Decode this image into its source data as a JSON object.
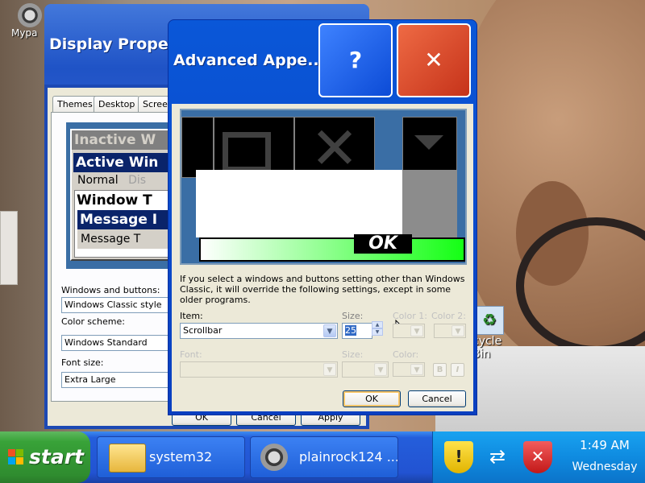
{
  "desktop": {
    "icons": [
      {
        "label": "Mypa"
      },
      {
        "label": "cycle\nBin"
      }
    ]
  },
  "display_properties": {
    "title": "Display Propert",
    "tabs": [
      "Themes",
      "Desktop",
      "Screen"
    ],
    "preview": {
      "inactive_window": "Inactive W",
      "active_window": "Active Win",
      "menu_normal": "Normal",
      "menu_disabled": "Dis",
      "window_text": "Window T",
      "message_box": "Message I",
      "message_text": "Message T"
    },
    "windows_and_buttons_label": "Windows and buttons:",
    "windows_and_buttons_value": "Windows Classic style",
    "color_scheme_label": "Color scheme:",
    "color_scheme_value": "Windows Standard",
    "font_size_label": "Font size:",
    "font_size_value": "Extra Large",
    "bottom_buttons": [
      "OK",
      "Cancel",
      "Apply"
    ]
  },
  "advanced_appearance": {
    "title": "Advanced Appe...",
    "help_label": "?",
    "close_label": "✕",
    "preview_ok": "OK",
    "note": "If you select a windows and buttons setting other than Windows Classic, it will override the following settings, except in some older programs.",
    "item_label": "Item:",
    "item_value": "Scrollbar",
    "size_label": "Size:",
    "size_value": "25",
    "color1_label": "Color 1:",
    "color2_label": "Color 2:",
    "font_label": "Font:",
    "font_size_label": "Size:",
    "font_color_label": "Color:",
    "bold_label": "B",
    "italic_label": "I",
    "ok_label": "OK",
    "cancel_label": "Cancel"
  },
  "taskbar": {
    "start_label": "start",
    "tasks": [
      {
        "label": "system32"
      },
      {
        "label": "plainrock124 ..."
      }
    ],
    "clock_time": "1:49 AM",
    "clock_day": "Wednesday"
  },
  "colors": {
    "taskbar_blue": "#245edb",
    "start_green": "#38a238",
    "close_red": "#d4471f"
  }
}
